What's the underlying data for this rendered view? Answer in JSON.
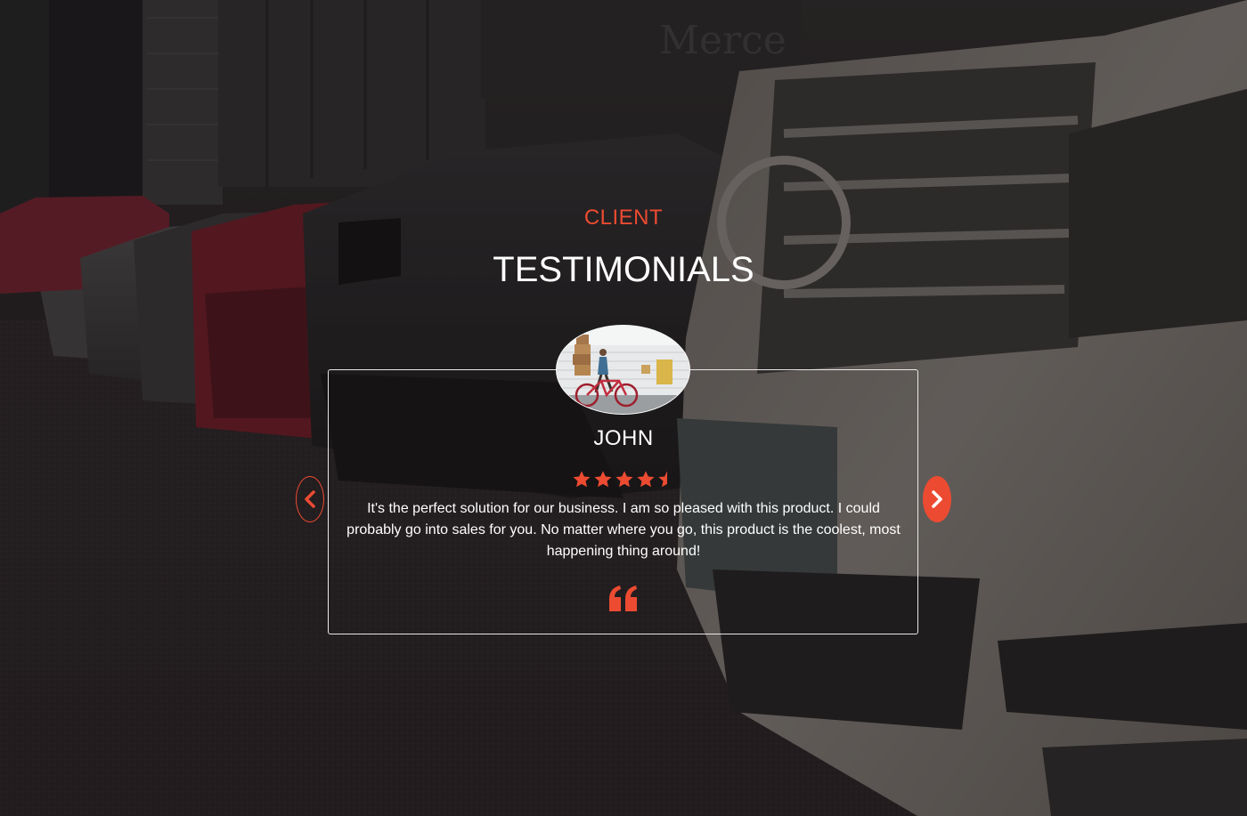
{
  "section": {
    "eyebrow": "CLIENT",
    "title": "TESTIMONIALS"
  },
  "testimonial": {
    "name": "JOHN",
    "rating": 4.5,
    "rating_max": 5,
    "text": "It's the perfect solution for our business. I am so pleased with this product. I could probably go into sales for you. No matter where you go, this product is the coolest, most happening thing around!"
  },
  "icons": {
    "prev": "chevron-left-icon",
    "next": "chevron-right-icon",
    "quote": "quote-icon",
    "star": "star-icon"
  },
  "colors": {
    "accent": "#ec4b32",
    "text": "#ffffff"
  }
}
